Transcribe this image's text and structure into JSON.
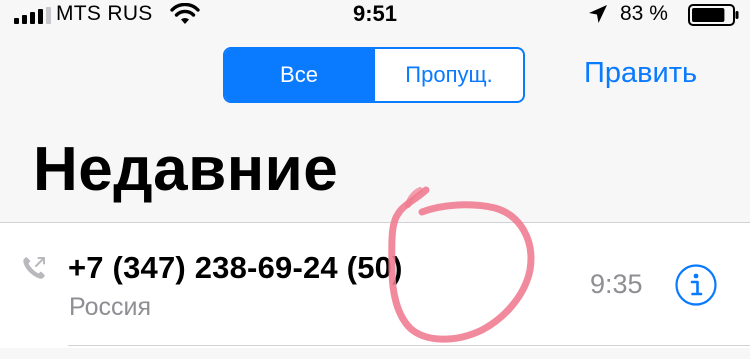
{
  "status_bar": {
    "carrier": "MTS RUS",
    "time": "9:51",
    "battery_percent": "83 %",
    "battery_level": 0.83,
    "icons": [
      "signal-icon",
      "wifi-icon",
      "location-arrow-icon",
      "battery-icon"
    ]
  },
  "segmented_control": {
    "all_label": "Все",
    "missed_label": "Пропущ.",
    "selected": "all"
  },
  "header": {
    "edit_label": "Править",
    "title": "Недавние"
  },
  "recents": [
    {
      "number": "+7 (347) 238-69-24 (50)",
      "country": "Россия",
      "time": "9:35"
    }
  ],
  "colors": {
    "accent": "#0a7aff",
    "secondary_text": "#8e8e93",
    "annotation": "#f07a8f"
  }
}
